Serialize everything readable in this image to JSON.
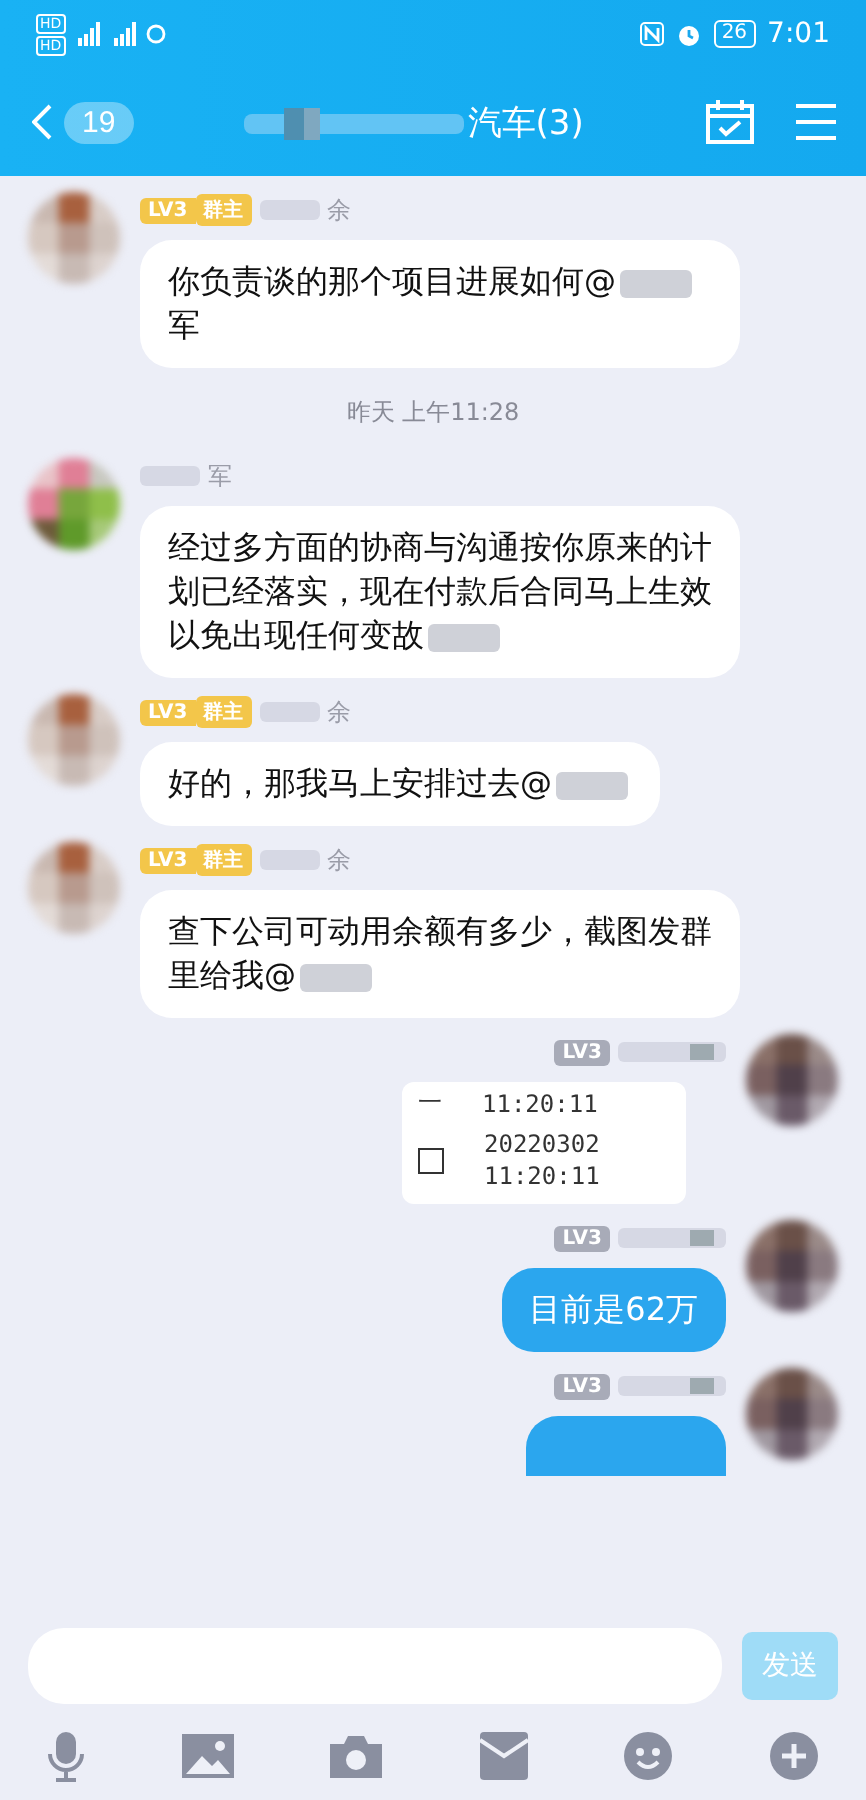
{
  "status_bar": {
    "hd_labels": [
      "HD",
      "HD"
    ],
    "battery": "26",
    "time": "7:01"
  },
  "header": {
    "unread": "19",
    "title": "汽车(3)"
  },
  "messages": [
    {
      "kind": "in",
      "badges": [
        {
          "text": "LV3",
          "kind": "level"
        },
        {
          "text": "群主",
          "kind": "role"
        }
      ],
      "name": "余",
      "text": "你负责谈的那个项目进展如何@",
      "mention_tail": "军"
    },
    {
      "kind": "time",
      "text": "昨天 上午11:28"
    },
    {
      "kind": "in",
      "name": "军",
      "text": "经过多方面的协商与沟通按你原来的计划已经落实，现在付款后合同马上生效以免出现任何变故"
    },
    {
      "kind": "in",
      "badges": [
        {
          "text": "LV3",
          "kind": "level"
        },
        {
          "text": "群主",
          "kind": "role"
        }
      ],
      "name": "余",
      "text": "好的，那我马上安排过去@"
    },
    {
      "kind": "in",
      "badges": [
        {
          "text": "LV3",
          "kind": "level"
        },
        {
          "text": "群主",
          "kind": "role"
        }
      ],
      "name": "余",
      "text": "查下公司可动用余额有多少，截图发群里给我@"
    },
    {
      "kind": "out_shot",
      "badges": [
        {
          "text": "LV3",
          "kind": "gray"
        }
      ],
      "rows": [
        {
          "mark": "一",
          "checkbox": false,
          "lines": [
            "11:20:11"
          ]
        },
        {
          "checkbox": true,
          "lines": [
            "20220302",
            "11:20:11"
          ]
        }
      ]
    },
    {
      "kind": "out",
      "badges": [
        {
          "text": "LV3",
          "kind": "gray"
        }
      ],
      "text": "目前是62万"
    },
    {
      "kind": "out_cut",
      "badges": [
        {
          "text": "LV3",
          "kind": "gray"
        }
      ]
    }
  ],
  "input": {
    "send": "发送"
  }
}
